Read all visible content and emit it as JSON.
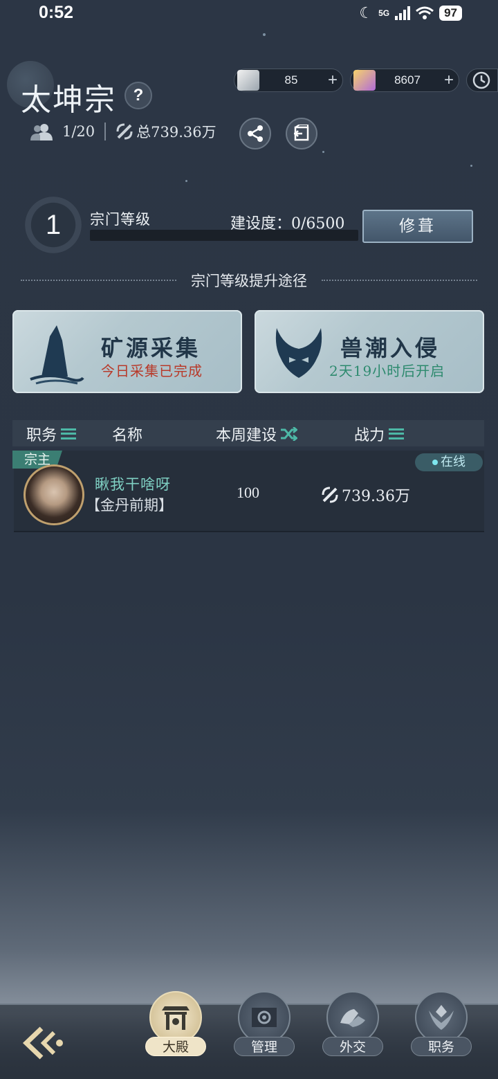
{
  "status_bar": {
    "time": "0:52",
    "network": "5G",
    "battery": "97"
  },
  "header": {
    "sect_name": "太坤宗",
    "help_icon": "?",
    "members": "1/20",
    "total_power": "总739.36万"
  },
  "currencies": [
    {
      "name": "scroll-currency",
      "value": "85",
      "plus": "+"
    },
    {
      "name": "crystal-currency",
      "value": "8607",
      "plus": "+"
    }
  ],
  "level": {
    "number": "1",
    "label": "宗门等级",
    "build_progress": "建设度：0/6500",
    "progress_fraction": 0,
    "repair_button": "修葺"
  },
  "upgrade_paths": {
    "title": "宗门等级提升途径",
    "cards": [
      {
        "title": "矿源采集",
        "subtitle": "今日采集已完成"
      },
      {
        "title": "兽潮入侵",
        "subtitle": "2天19小时后开启"
      }
    ]
  },
  "members_table": {
    "columns": [
      "职务",
      "名称",
      "本周建设",
      "战力"
    ],
    "rows": [
      {
        "role": "宗主",
        "name": "瞅我干啥呀",
        "realm": "【金丹前期】",
        "weekly_build": "100",
        "power": "739.36万",
        "status": "在线"
      }
    ]
  },
  "bottom_nav": {
    "items": [
      {
        "label": "大殿",
        "active": true
      },
      {
        "label": "管理",
        "active": false
      },
      {
        "label": "外交",
        "active": false
      },
      {
        "label": "职务",
        "active": false
      }
    ]
  },
  "colors": {
    "accent_teal": "#4db8a6",
    "online": "#7ee6ee",
    "card_bg": "#b4c8cf"
  }
}
